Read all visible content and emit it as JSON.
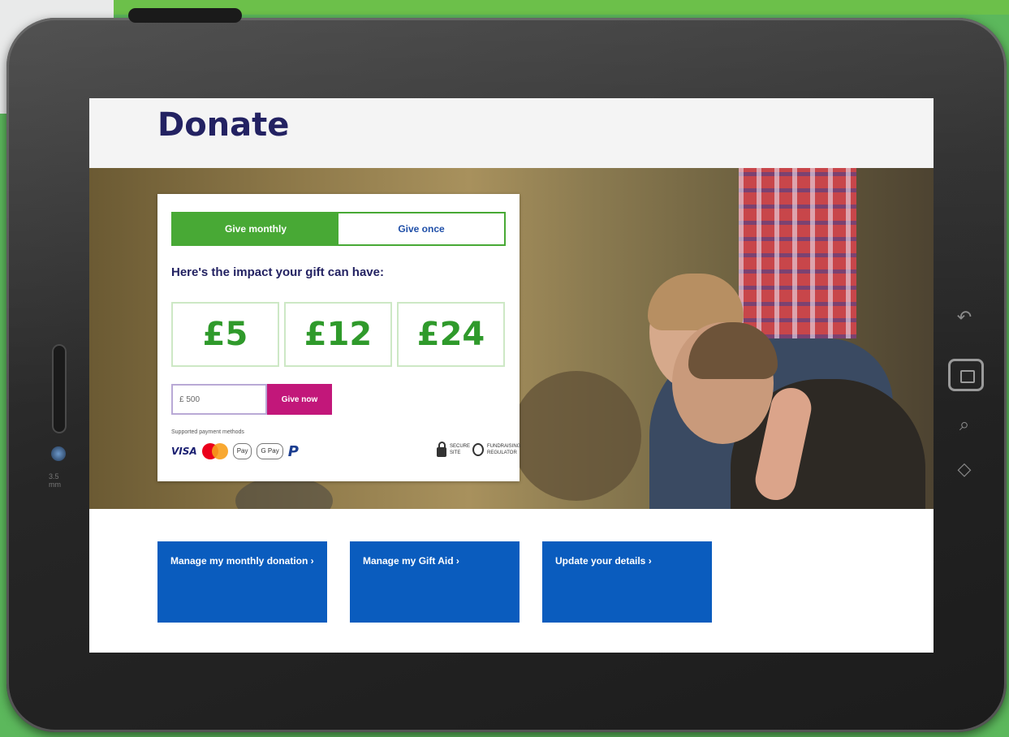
{
  "page": {
    "title": "Donate"
  },
  "donation_card": {
    "tabs": [
      {
        "label": "Give monthly",
        "active": true
      },
      {
        "label": "Give once",
        "active": false
      }
    ],
    "impact_heading": "Here's the impact your gift can have:",
    "amounts": [
      "£5",
      "£12",
      "£24"
    ],
    "amount_input_value": "£ 500",
    "give_button_label": "Give now",
    "payment_methods_label": "Supported payment methods",
    "payment_icons": [
      "visa",
      "mastercard",
      "apple-pay",
      "google-pay",
      "paypal"
    ],
    "visa_label": "VISA",
    "apple_pay_label": "Pay",
    "google_pay_label": "G Pay",
    "paypal_label": "P",
    "secure_label": "SECURE SITE",
    "secure_label_2": "FUNDRAISING REGULATOR"
  },
  "tiles": [
    {
      "label": "Manage my monthly donation ›"
    },
    {
      "label": "Manage my Gift Aid ›"
    },
    {
      "label": "Update your details ›"
    }
  ],
  "device": {
    "side_text": "3.5 mm"
  },
  "colors": {
    "accent_green": "#48a935",
    "give_now": "#c2177a",
    "tile_blue": "#0a5cbe",
    "title_navy": "#232262",
    "background_green": "#5cb85c"
  }
}
